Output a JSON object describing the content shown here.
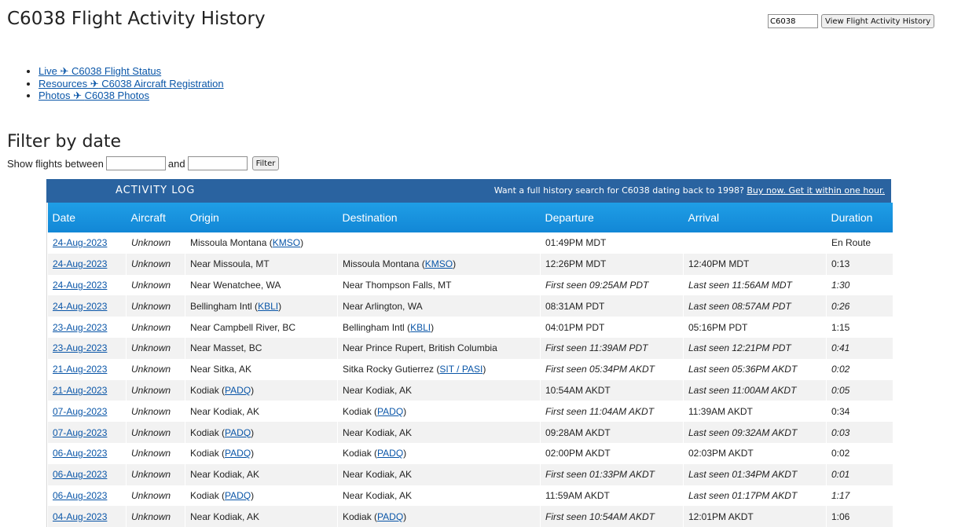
{
  "page": {
    "title": "C6038 Flight Activity History",
    "search_value": "C6038",
    "search_button": "View Flight Activity History"
  },
  "links": [
    {
      "prefix": "Live ✈",
      "label": "C6038 Flight Status"
    },
    {
      "prefix": "Resources ✈",
      "label": "C6038 Aircraft Registration"
    },
    {
      "prefix": "Photos ✈",
      "label": "C6038 Photos"
    }
  ],
  "filter": {
    "title": "Filter by date",
    "label": "Show flights between",
    "and_label": "and",
    "from_value": "",
    "to_value": "",
    "button": "Filter"
  },
  "activity_log": {
    "title": "ACTIVITY LOG",
    "promo_text": "Want a full history search for C6038 dating back to 1998?",
    "promo_link": "Buy now. Get it within one hour."
  },
  "table": {
    "headers": [
      "Date",
      "Aircraft",
      "Origin",
      "Destination",
      "Departure",
      "Arrival",
      "Duration"
    ],
    "rows": [
      {
        "date": "24-Aug-2023",
        "aircraft": "Unknown",
        "origin": {
          "text": "Missoula Montana",
          "code": "KMSO"
        },
        "destination": {
          "text": ""
        },
        "departure": {
          "text": "01:49PM MDT",
          "italic": false
        },
        "arrival": {
          "text": "",
          "italic": false
        },
        "duration": {
          "text": "En Route",
          "italic": false
        }
      },
      {
        "date": "24-Aug-2023",
        "aircraft": "Unknown",
        "origin": {
          "text": "Near Missoula, MT"
        },
        "destination": {
          "text": "Missoula Montana",
          "code": "KMSO"
        },
        "departure": {
          "text": "12:26PM MDT",
          "italic": false
        },
        "arrival": {
          "text": "12:40PM MDT",
          "italic": false
        },
        "duration": {
          "text": "0:13",
          "italic": false
        }
      },
      {
        "date": "24-Aug-2023",
        "aircraft": "Unknown",
        "origin": {
          "text": "Near Wenatchee, WA"
        },
        "destination": {
          "text": "Near Thompson Falls, MT"
        },
        "departure": {
          "text": "First seen 09:25AM PDT",
          "italic": true
        },
        "arrival": {
          "text": "Last seen 11:56AM MDT",
          "italic": true
        },
        "duration": {
          "text": "1:30",
          "italic": true
        }
      },
      {
        "date": "24-Aug-2023",
        "aircraft": "Unknown",
        "origin": {
          "text": "Bellingham Intl",
          "code": "KBLI"
        },
        "destination": {
          "text": "Near Arlington, WA"
        },
        "departure": {
          "text": "08:31AM PDT",
          "italic": false
        },
        "arrival": {
          "text": "Last seen 08:57AM PDT",
          "italic": true
        },
        "duration": {
          "text": "0:26",
          "italic": true
        }
      },
      {
        "date": "23-Aug-2023",
        "aircraft": "Unknown",
        "origin": {
          "text": "Near Campbell River, BC"
        },
        "destination": {
          "text": "Bellingham Intl",
          "code": "KBLI"
        },
        "departure": {
          "text": "04:01PM PDT",
          "italic": false
        },
        "arrival": {
          "text": "05:16PM PDT",
          "italic": false
        },
        "duration": {
          "text": "1:15",
          "italic": false
        }
      },
      {
        "date": "23-Aug-2023",
        "aircraft": "Unknown",
        "origin": {
          "text": "Near Masset, BC"
        },
        "destination": {
          "text": "Near Prince Rupert, British Columbia"
        },
        "departure": {
          "text": "First seen 11:39AM PDT",
          "italic": true
        },
        "arrival": {
          "text": "Last seen 12:21PM PDT",
          "italic": true
        },
        "duration": {
          "text": "0:41",
          "italic": true
        }
      },
      {
        "date": "21-Aug-2023",
        "aircraft": "Unknown",
        "origin": {
          "text": "Near Sitka, AK"
        },
        "destination": {
          "text": "Sitka Rocky Gutierrez",
          "code": "SIT / PASI"
        },
        "departure": {
          "text": "First seen 05:34PM AKDT",
          "italic": true
        },
        "arrival": {
          "text": "Last seen 05:36PM AKDT",
          "italic": true
        },
        "duration": {
          "text": "0:02",
          "italic": true
        }
      },
      {
        "date": "21-Aug-2023",
        "aircraft": "Unknown",
        "origin": {
          "text": "Kodiak",
          "code": "PADQ"
        },
        "destination": {
          "text": "Near Kodiak, AK"
        },
        "departure": {
          "text": "10:54AM AKDT",
          "italic": false
        },
        "arrival": {
          "text": "Last seen 11:00AM AKDT",
          "italic": true
        },
        "duration": {
          "text": "0:05",
          "italic": true
        }
      },
      {
        "date": "07-Aug-2023",
        "aircraft": "Unknown",
        "origin": {
          "text": "Near Kodiak, AK"
        },
        "destination": {
          "text": "Kodiak",
          "code": "PADQ"
        },
        "departure": {
          "text": "First seen 11:04AM AKDT",
          "italic": true
        },
        "arrival": {
          "text": "11:39AM AKDT",
          "italic": false
        },
        "duration": {
          "text": "0:34",
          "italic": false
        }
      },
      {
        "date": "07-Aug-2023",
        "aircraft": "Unknown",
        "origin": {
          "text": "Kodiak",
          "code": "PADQ"
        },
        "destination": {
          "text": "Near Kodiak, AK"
        },
        "departure": {
          "text": "09:28AM AKDT",
          "italic": false
        },
        "arrival": {
          "text": "Last seen 09:32AM AKDT",
          "italic": true
        },
        "duration": {
          "text": "0:03",
          "italic": true
        }
      },
      {
        "date": "06-Aug-2023",
        "aircraft": "Unknown",
        "origin": {
          "text": "Kodiak",
          "code": "PADQ"
        },
        "destination": {
          "text": "Kodiak",
          "code": "PADQ"
        },
        "departure": {
          "text": "02:00PM AKDT",
          "italic": false
        },
        "arrival": {
          "text": "02:03PM AKDT",
          "italic": false
        },
        "duration": {
          "text": "0:02",
          "italic": false
        }
      },
      {
        "date": "06-Aug-2023",
        "aircraft": "Unknown",
        "origin": {
          "text": "Near Kodiak, AK"
        },
        "destination": {
          "text": "Near Kodiak, AK"
        },
        "departure": {
          "text": "First seen 01:33PM AKDT",
          "italic": true
        },
        "arrival": {
          "text": "Last seen 01:34PM AKDT",
          "italic": true
        },
        "duration": {
          "text": "0:01",
          "italic": true
        }
      },
      {
        "date": "06-Aug-2023",
        "aircraft": "Unknown",
        "origin": {
          "text": "Kodiak",
          "code": "PADQ"
        },
        "destination": {
          "text": "Near Kodiak, AK"
        },
        "departure": {
          "text": "11:59AM AKDT",
          "italic": false
        },
        "arrival": {
          "text": "Last seen 01:17PM AKDT",
          "italic": true
        },
        "duration": {
          "text": "1:17",
          "italic": true
        }
      },
      {
        "date": "04-Aug-2023",
        "aircraft": "Unknown",
        "origin": {
          "text": "Near Kodiak, AK"
        },
        "destination": {
          "text": "Kodiak",
          "code": "PADQ"
        },
        "departure": {
          "text": "First seen 10:54AM AKDT",
          "italic": true
        },
        "arrival": {
          "text": "12:01PM AKDT",
          "italic": false
        },
        "duration": {
          "text": "1:06",
          "italic": false
        }
      }
    ]
  }
}
